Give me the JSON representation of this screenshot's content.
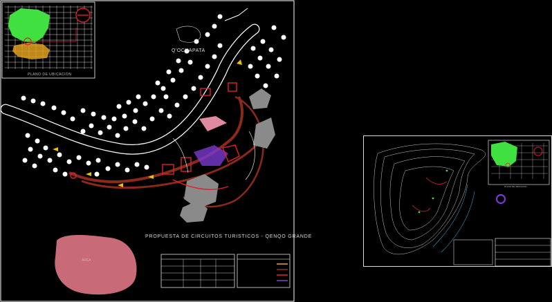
{
  "drawing": {
    "title": "PROPUESTA DE CIRCUITOS TURISTICOS - QENQO GRANDE",
    "town_label": "Q'OCHAPATA",
    "location_plan_caption": "PLANO DE UBICACION",
    "detail_location_caption": "PLANO DE UBICACION"
  },
  "colors": {
    "background": "#000000",
    "road": "#ffffff",
    "trail": "#8b2a1a",
    "rock": "#8a8a8a",
    "area_pink": "#c96a78",
    "district_green": "#3fe03f",
    "arrow": "#e6c200",
    "structure_red": "#e0202c"
  },
  "icons": [
    "north-arrow-icon",
    "scale-bar-icon",
    "tree-symbol-icon"
  ]
}
